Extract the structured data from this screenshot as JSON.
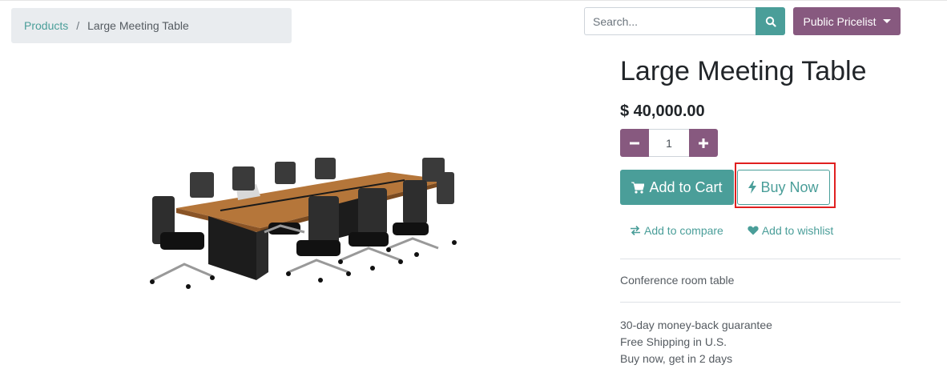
{
  "breadcrumb": {
    "root": "Products",
    "separator": "/",
    "current": "Large Meeting Table"
  },
  "search": {
    "placeholder": "Search..."
  },
  "pricelist": {
    "label": "Public Pricelist"
  },
  "product": {
    "title": "Large Meeting Table",
    "price": "$ 40,000.00",
    "quantity": "1",
    "description": "Conference room table",
    "terms": [
      "30-day money-back guarantee",
      "Free Shipping in U.S.",
      "Buy now, get in 2 days"
    ]
  },
  "actions": {
    "add_to_cart": "Add to Cart",
    "buy_now": "Buy Now",
    "compare": "Add to compare",
    "wishlist": "Add to wishlist"
  },
  "colors": {
    "accent": "#4a9e99",
    "secondary": "#87597f",
    "highlight": "#e02020"
  },
  "icons": [
    "search-icon",
    "caret-down-icon",
    "minus-icon",
    "plus-icon",
    "cart-icon",
    "bolt-icon",
    "exchange-icon",
    "heart-icon"
  ]
}
